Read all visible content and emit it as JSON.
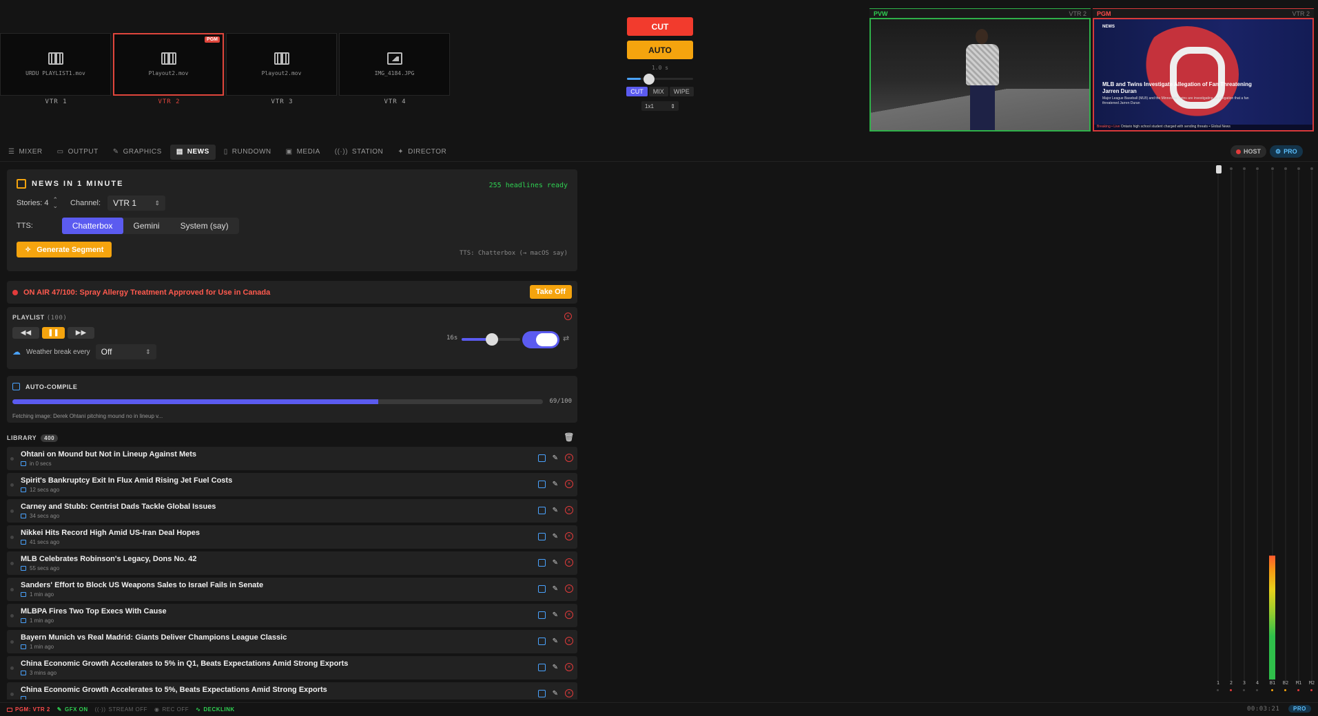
{
  "vtrs": [
    {
      "file": "URDU PLAYLIST1.mov",
      "label": "VTR 1",
      "type": "film"
    },
    {
      "file": "Playout2.mov",
      "label": "VTR 2",
      "type": "film",
      "badge": "PGM"
    },
    {
      "file": "Playout2.mov",
      "label": "VTR 3",
      "type": "film"
    },
    {
      "file": "IMG_4184.JPG",
      "label": "VTR 4",
      "type": "image"
    }
  ],
  "transition": {
    "cut_label": "CUT",
    "auto_label": "AUTO",
    "duration": "1.0 s",
    "tbar_position": 0.15,
    "types": [
      "CUT",
      "MIX",
      "WIPE"
    ],
    "selected_type": "CUT",
    "layout": "1x1"
  },
  "preview": {
    "tag": "PVW",
    "source": "VTR 2"
  },
  "program": {
    "tag": "PGM",
    "source": "VTR 2",
    "overlay_brand": "NEWS",
    "headline": "MLB and Twins Investigate Allegation of Fan Threatening Jarren Duran",
    "subtext": "Major League Baseball (MLB) and the Minnesota Twins are investigating an allegation that a fan threatened Jarren Duran",
    "ticker_left": "Breaking • Live",
    "ticker_text": "Ontario high school student charged with sending threats • Global News"
  },
  "tabs": [
    {
      "label": "MIXER",
      "icon": "sliders-icon",
      "glyph": "☰"
    },
    {
      "label": "OUTPUT",
      "icon": "monitor-icon",
      "glyph": "▭"
    },
    {
      "label": "GRAPHICS",
      "icon": "brush-icon",
      "glyph": "✎"
    },
    {
      "label": "NEWS",
      "icon": "newspaper-icon",
      "glyph": "▤",
      "active": true
    },
    {
      "label": "RUNDOWN",
      "icon": "document-icon",
      "glyph": "▯"
    },
    {
      "label": "MEDIA",
      "icon": "archive-icon",
      "glyph": "▣"
    },
    {
      "label": "STATION",
      "icon": "antenna-icon",
      "glyph": "((·))"
    },
    {
      "label": "DIRECTOR",
      "icon": "wand-icon",
      "glyph": "✦"
    }
  ],
  "host_label": "HOST",
  "pro_label": "PRO",
  "news": {
    "title": "NEWS IN 1 MINUTE",
    "headlines_ready": "255 headlines ready",
    "stories_label": "Stories: 4",
    "channel_label": "Channel:",
    "channel_value": "VTR 1",
    "tts_label": "TTS:",
    "tts_options": [
      "Chatterbox",
      "Gemini",
      "System (say)"
    ],
    "tts_selected": "Chatterbox",
    "generate_label": "Generate Segment",
    "tts_note": "TTS: Chatterbox (→ macOS say)"
  },
  "on_air": {
    "text": "ON AIR 47/100: Spray Allergy Treatment Approved for Use in Canada",
    "take_off_label": "Take Off"
  },
  "playlist": {
    "title": "PLAYLIST",
    "count": "(100)",
    "interval": "16s",
    "interval_fraction": 0.45,
    "loop_on": true,
    "weather_label": "Weather break every",
    "weather_value": "Off"
  },
  "compile": {
    "title": "AUTO-COMPILE",
    "progress": 0.69,
    "count": "69/100",
    "status": "Fetching image: Derek Ohtani pitching mound no in lineup v..."
  },
  "library": {
    "title": "LIBRARY",
    "count": "400",
    "stories": [
      {
        "title": "Ohtani on Mound but Not in Lineup Against Mets",
        "time": "in 0 secs"
      },
      {
        "title": "Spirit's Bankruptcy Exit In Flux Amid Rising Jet Fuel Costs",
        "time": "12 secs ago"
      },
      {
        "title": "Carney and Stubb: Centrist Dads Tackle Global Issues",
        "time": "34 secs ago"
      },
      {
        "title": "Nikkei Hits Record High Amid US-Iran Deal Hopes",
        "time": "41 secs ago"
      },
      {
        "title": "MLB Celebrates Robinson's Legacy, Dons No. 42",
        "time": "55 secs ago"
      },
      {
        "title": "Sanders' Effort to Block US Weapons Sales to Israel Fails in Senate",
        "time": "1 min ago"
      },
      {
        "title": "MLBPA Fires Two Top Execs With Cause",
        "time": "1 min ago"
      },
      {
        "title": "Bayern Munich vs Real Madrid: Giants Deliver Champions League Classic",
        "time": "1 min ago"
      },
      {
        "title": "China Economic Growth Accelerates to 5% in Q1, Beats Expectations Amid Strong Exports",
        "time": "3 mins ago"
      },
      {
        "title": "China Economic Growth Accelerates to 5%, Beats Expectations Amid Strong Exports",
        "time": ""
      }
    ]
  },
  "mixer_channels": [
    {
      "name": "1",
      "dot": "none"
    },
    {
      "name": "2",
      "dot": "red"
    },
    {
      "name": "3",
      "dot": "none"
    },
    {
      "name": "4",
      "dot": "none"
    },
    {
      "name": "B1",
      "dot": "orange"
    },
    {
      "name": "B2",
      "dot": "orange"
    },
    {
      "name": "M1",
      "dot": "red"
    },
    {
      "name": "M2",
      "dot": "red"
    }
  ],
  "status": {
    "pgm": "PGM: VTR 2",
    "gfx": "GFX ON",
    "stream": "STREAM OFF",
    "rec": "REC OFF",
    "decklink": "DECKLINK",
    "timecode": "00:03:21",
    "pro": "PRO"
  }
}
